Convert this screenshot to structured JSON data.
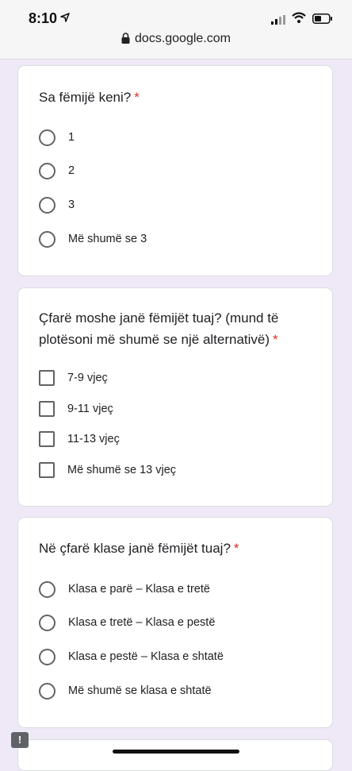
{
  "status_bar": {
    "time": "8:10",
    "icons": [
      "location-arrow-icon",
      "signal-icon",
      "wifi-icon",
      "battery-icon"
    ]
  },
  "browser": {
    "url": "docs.google.com"
  },
  "required_marker": "*",
  "colors": {
    "background": "#efe9f7",
    "required": "#d93025"
  },
  "questions": [
    {
      "title": "Sa fëmijë keni?",
      "type": "radio",
      "options": [
        "1",
        "2",
        "3",
        "Më shumë se 3"
      ]
    },
    {
      "title_line1": "Çfarë moshe janë fëmijët tuaj? (mund të",
      "title_line2": "plotësoni më shumë se një alternativë)",
      "type": "checkbox",
      "options": [
        "7-9 vjeç",
        "9-11 vjeç",
        "11-13 vjeç",
        "Më shumë se 13 vjeç"
      ]
    },
    {
      "title": "Në çfarë klase janë fëmijët tuaj?",
      "type": "radio",
      "options": [
        "Klasa e parë – Klasa e tretë",
        "Klasa e tretë – Klasa e pestë",
        "Klasa e pestë – Klasa e shtatë",
        "Më shumë se klasa e shtatë"
      ]
    }
  ],
  "feedback_icon": "!"
}
